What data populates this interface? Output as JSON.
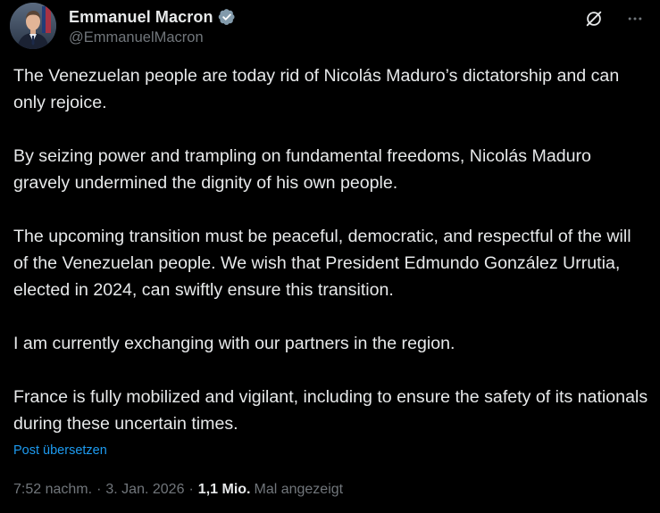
{
  "author": {
    "display_name": "Emmanuel Macron",
    "handle": "@EmmanuelMacron",
    "verified": true,
    "avatar_icon": "person-portrait"
  },
  "header_actions": {
    "grok_icon": "slashed-circle-icon",
    "more_icon": "more-horizontal-icon"
  },
  "post": {
    "paragraphs": [
      "The Venezuelan people are today rid of Nicolás Maduro’s dictatorship and can only rejoice.",
      "By seizing power and trampling on fundamental freedoms, Nicolás Maduro gravely undermined the dignity of his own people.",
      "The upcoming transition must be peaceful, democratic, and respectful of the will of the Venezuelan people. We wish that President Edmundo González Urrutia, elected in 2024, can swiftly ensure this transition.",
      "I am currently exchanging with our partners in the region.",
      "France is fully mobilized and vigilant, including to ensure the safety of its nationals during these uncertain times."
    ],
    "translate_label": "Post übersetzen"
  },
  "meta": {
    "time": "7:52 nachm.",
    "separator": "·",
    "date": "3. Jan. 2026",
    "views_count": "1,1 Mio.",
    "views_label": "Mal angezeigt"
  },
  "colors": {
    "background": "#000000",
    "text_primary": "#e7e9ea",
    "text_secondary": "#71767b",
    "link": "#1d9bf0",
    "verified_badge": "#829aab"
  }
}
